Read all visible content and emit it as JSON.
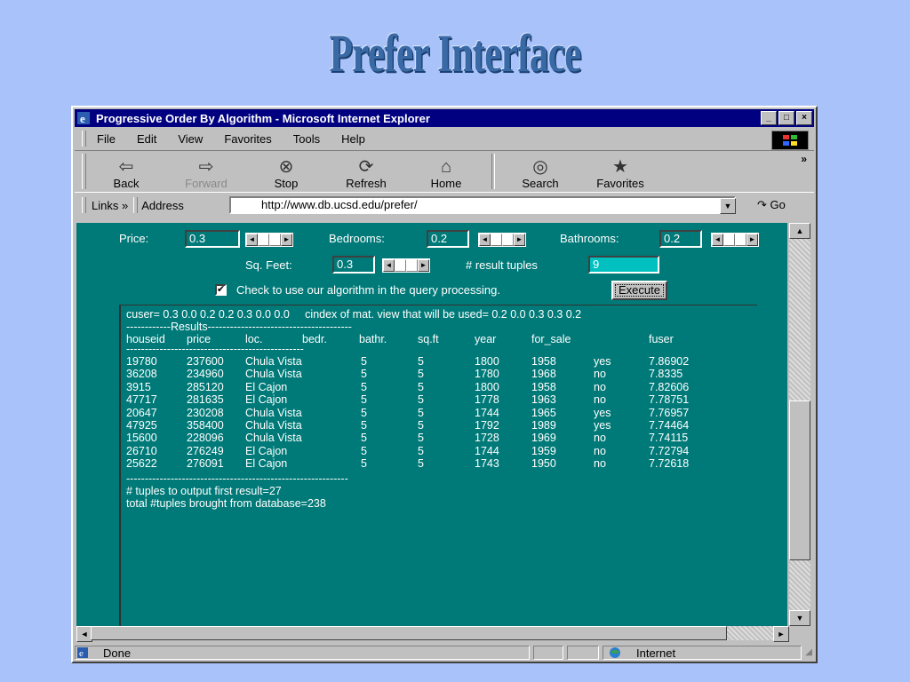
{
  "slide": {
    "title": "Prefer Interface"
  },
  "window": {
    "title": "Progressive Order By Algorithm - Microsoft Internet Explorer",
    "minimize": "_",
    "maximize": "□",
    "close": "×"
  },
  "menu": [
    "File",
    "Edit",
    "View",
    "Favorites",
    "Tools",
    "Help"
  ],
  "toolbar": {
    "back": "Back",
    "forward": "Forward",
    "stop": "Stop",
    "refresh": "Refresh",
    "home": "Home",
    "search": "Search",
    "favorites": "Favorites",
    "more": "»"
  },
  "address": {
    "links": "Links »",
    "label": "Address",
    "url": "http://www.db.ucsd.edu/prefer/",
    "go": "Go"
  },
  "form": {
    "price_label": "Price:",
    "price_value": "0.3",
    "bedrooms_label": "Bedrooms:",
    "bedrooms_value": "0.2",
    "bathrooms_label": "Bathrooms:",
    "bathrooms_value": "0.2",
    "sqfeet_label": "Sq. Feet:",
    "sqfeet_value": "0.3",
    "tuples_label": "# result tuples",
    "tuples_value": "9",
    "check_label": "Check to use our algorithm in the query processing.",
    "execute": "Execute"
  },
  "results": {
    "cuser_line": "cuser= 0.3 0.0 0.2 0.2 0.3 0.0 0.0     cindex of mat. view that will be used= 0.2 0.0 0.3 0.3 0.2",
    "results_line": "------------Results---------------------------------------",
    "columns": [
      "houseid",
      "price",
      "loc.",
      "bedr.",
      "bathr.",
      "sq.ft",
      "year",
      "for_sale",
      "fuser"
    ],
    "underline": "------------------------------------------------",
    "rows": [
      [
        "19780",
        "237600",
        "Chula Vista",
        "5",
        "5",
        "1800",
        "1958",
        "yes",
        "7.86902"
      ],
      [
        "36208",
        "234960",
        "Chula Vista",
        "5",
        "5",
        "1780",
        "1968",
        "no",
        "7.8335"
      ],
      [
        "3915",
        "285120",
        "El Cajon",
        "5",
        "5",
        "1800",
        "1958",
        "no",
        "7.82606"
      ],
      [
        "47717",
        "281635",
        "El Cajon",
        "5",
        "5",
        "1778",
        "1963",
        "no",
        "7.78751"
      ],
      [
        "20647",
        "230208",
        "Chula Vista",
        "5",
        "5",
        "1744",
        "1965",
        "yes",
        "7.76957"
      ],
      [
        "47925",
        "358400",
        "Chula Vista",
        "5",
        "5",
        "1792",
        "1989",
        "yes",
        "7.74464"
      ],
      [
        "15600",
        "228096",
        "Chula Vista",
        "5",
        "5",
        "1728",
        "1969",
        "no",
        "7.74115"
      ],
      [
        "26710",
        "276249",
        "El Cajon",
        "5",
        "5",
        "1744",
        "1959",
        "no",
        "7.72794"
      ],
      [
        "25622",
        "276091",
        "El Cajon",
        "5",
        "5",
        "1743",
        "1950",
        "no",
        "7.72618"
      ]
    ],
    "footer_dash": "------------------------------------------------------------",
    "first_result": "# tuples to output first result=27",
    "total": "total #tuples brought from database=238"
  },
  "status": {
    "text": "Done",
    "zone": "Internet"
  },
  "colors": {
    "page": "#007a78",
    "titlebar": "#000080",
    "slide_bg": "#a9c2f9"
  }
}
